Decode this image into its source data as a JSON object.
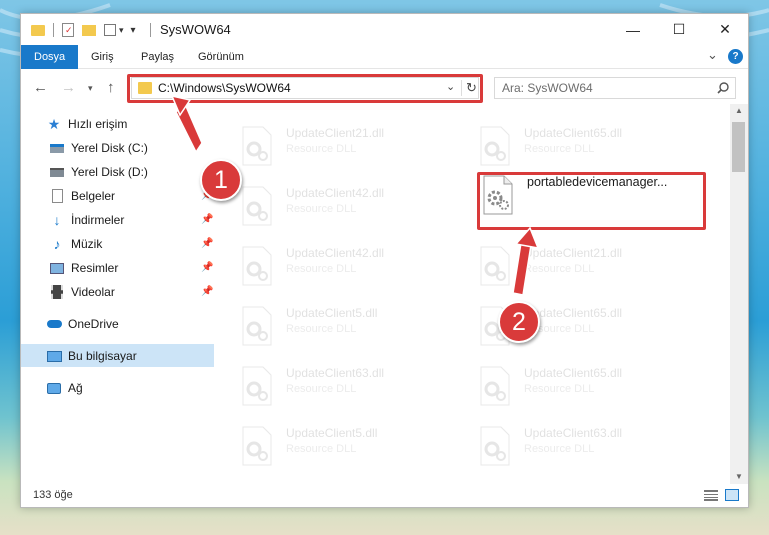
{
  "window": {
    "title": "SysWOW64",
    "minimize_glyph": "—",
    "maximize_glyph": "☐",
    "close_glyph": "✕"
  },
  "ribbon": {
    "tabs": [
      "Dosya",
      "Giriş",
      "Paylaş",
      "Görünüm"
    ],
    "expand_glyph": "⌄",
    "help_glyph": "?"
  },
  "address": {
    "path": "C:\\Windows\\SysWOW64",
    "search_placeholder": "Ara: SysWOW64"
  },
  "sidebar": {
    "items": [
      {
        "label": "Hızlı erişim",
        "icon": "star-icon"
      },
      {
        "label": "Yerel Disk (C:)",
        "icon": "drive-icon"
      },
      {
        "label": "Yerel Disk (D:)",
        "icon": "drive-icon"
      },
      {
        "label": "Belgeler",
        "icon": "documents-icon"
      },
      {
        "label": "İndirmeler",
        "icon": "download-icon"
      },
      {
        "label": "Müzik",
        "icon": "music-icon"
      },
      {
        "label": "Resimler",
        "icon": "pictures-icon"
      },
      {
        "label": "Videolar",
        "icon": "videos-icon"
      },
      {
        "label": "OneDrive",
        "icon": "cloud-icon"
      },
      {
        "label": "Bu bilgisayar",
        "icon": "computer-icon"
      },
      {
        "label": "Ağ",
        "icon": "network-icon"
      }
    ]
  },
  "files": {
    "highlighted": {
      "name": "portabledevicemanager..."
    },
    "faded": [
      {
        "name": "UpdateClient21.dll",
        "type": "Resource DLL"
      },
      {
        "name": "UpdateClient65.dll",
        "type": "Resource DLL"
      },
      {
        "name": "UpdateClient42.dll",
        "type": "Resource DLL"
      },
      {
        "name": "UpdateClient42.dll",
        "type": "Resource DLL"
      },
      {
        "name": "UpdateClient21.dll",
        "type": "Resource DLL"
      },
      {
        "name": "UpdateClient5.dll",
        "type": "Resource DLL"
      },
      {
        "name": "UpdateClient65.dll",
        "type": "Resource DLL"
      },
      {
        "name": "UpdateClient63.dll",
        "type": "Resource DLL"
      },
      {
        "name": "UpdateClient65.dll",
        "type": "Resource DLL"
      },
      {
        "name": "UpdateClient5.dll",
        "type": "Resource DLL"
      },
      {
        "name": "UpdateClient63.dll",
        "type": "Resource DLL"
      }
    ]
  },
  "status": {
    "count": "133 öğe"
  },
  "annotations": {
    "step1": "1",
    "step2": "2"
  },
  "colors": {
    "accent": "#1979ca",
    "highlight": "#d93a3a",
    "selected": "#cce4f7"
  }
}
